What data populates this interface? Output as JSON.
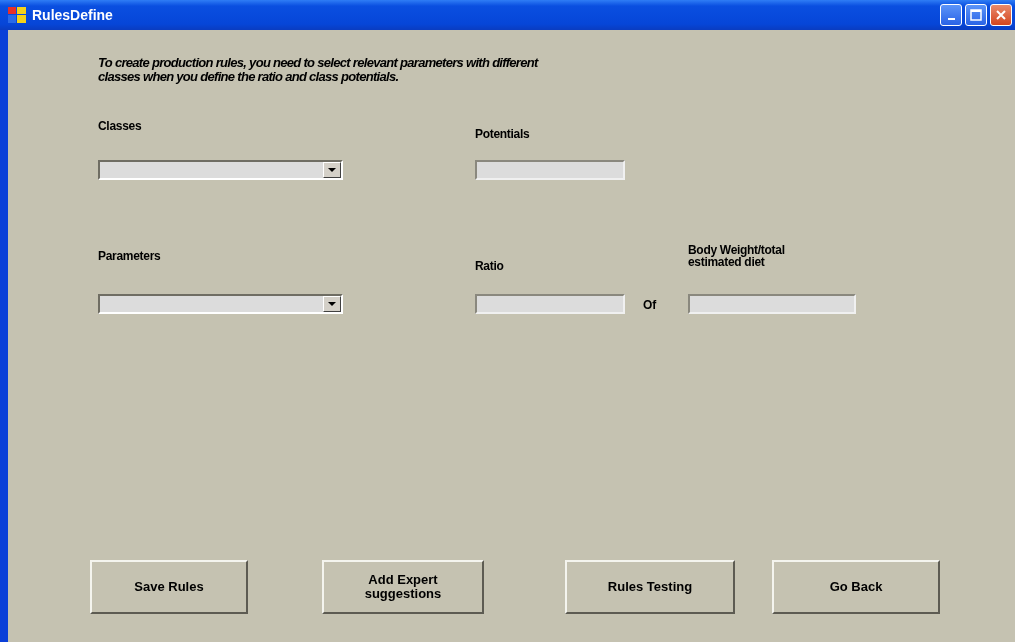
{
  "window": {
    "title": "RulesDefine"
  },
  "instructions": "To create production rules, you need to select relevant parameters with different classes when you define the ratio and class potentials.",
  "rows": [
    {
      "fields": [
        {
          "kind": "combo",
          "label": "Classes"
        },
        {
          "kind": "text",
          "label": "Potentials"
        }
      ]
    },
    {
      "fields": [
        {
          "kind": "combo",
          "label": "Parameters"
        },
        {
          "kind": "text",
          "label": "Ratio"
        },
        {
          "kind": "connector",
          "label": "Of"
        },
        {
          "kind": "text",
          "label": "Body Weight/total estimated diet"
        }
      ]
    }
  ],
  "buttons": [
    "Save Rules",
    "Add Expert suggestions",
    "Rules Testing",
    "Go Back"
  ]
}
